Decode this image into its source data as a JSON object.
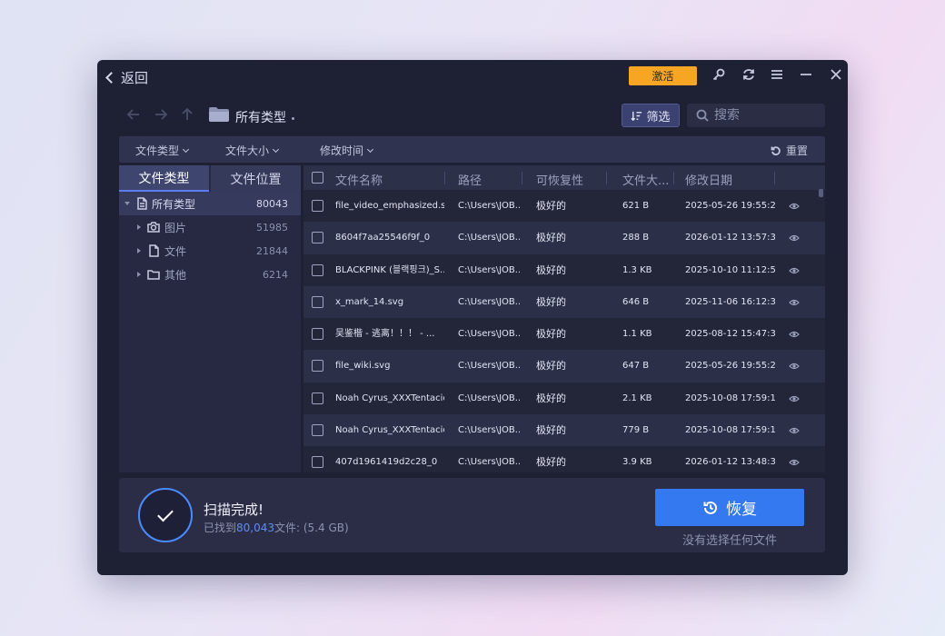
{
  "header": {
    "back_label": "返回",
    "activate_label": "激活"
  },
  "nav": {
    "breadcrumb": "所有类型",
    "filter_label": "筛选",
    "search_placeholder": "搜索"
  },
  "filter_bar": {
    "file_type": "文件类型",
    "file_size": "文件大小",
    "modified_time": "修改时间",
    "reset": "重置"
  },
  "left_panel": {
    "tabs": [
      "文件类型",
      "文件位置"
    ],
    "tree": [
      {
        "label": "所有类型",
        "count": "80043"
      },
      {
        "label": "图片",
        "count": "51985"
      },
      {
        "label": "文件",
        "count": "21844"
      },
      {
        "label": "其他",
        "count": "6214"
      }
    ]
  },
  "table": {
    "headers": {
      "name": "文件名称",
      "path": "路径",
      "recoverability": "可恢复性",
      "size": "文件大...",
      "modified": "修改日期"
    },
    "rows": [
      {
        "name": "file_video_emphasized.s...",
        "path": "C:\\Users\\JOB...",
        "recoverability": "极好的",
        "size": "621 B",
        "modified": "2025-05-26 19:55:24"
      },
      {
        "name": "8604f7aa25546f9f_0",
        "path": "C:\\Users\\JOB...",
        "recoverability": "极好的",
        "size": "288 B",
        "modified": "2026-01-12 13:57:30"
      },
      {
        "name": "BLACKPINK (블랙핑크)_S...",
        "path": "C:\\Users\\JOB...",
        "recoverability": "极好的",
        "size": "1.3 KB",
        "modified": "2025-10-10 11:12:50"
      },
      {
        "name": "x_mark_14.svg",
        "path": "C:\\Users\\JOB...",
        "recoverability": "极好的",
        "size": "646 B",
        "modified": "2025-11-06 16:12:30"
      },
      {
        "name": "吴鉴楷 - 逃离！！！ - ...",
        "path": "C:\\Users\\JOB...",
        "recoverability": "极好的",
        "size": "1.1 KB",
        "modified": "2025-08-12 15:47:37"
      },
      {
        "name": "file_wiki.svg",
        "path": "C:\\Users\\JOB...",
        "recoverability": "极好的",
        "size": "647 B",
        "modified": "2025-05-26 19:55:24"
      },
      {
        "name": "Noah Cyrus_XXXTentacio...",
        "path": "C:\\Users\\JOB...",
        "recoverability": "极好的",
        "size": "2.1 KB",
        "modified": "2025-10-08 17:59:19"
      },
      {
        "name": "Noah Cyrus_XXXTentacio...",
        "path": "C:\\Users\\JOB...",
        "recoverability": "极好的",
        "size": "779 B",
        "modified": "2025-10-08 17:59:19"
      },
      {
        "name": "407d1961419d2c28_0",
        "path": "C:\\Users\\JOB...",
        "recoverability": "极好的",
        "size": "3.9 KB",
        "modified": "2026-01-12 13:48:33"
      }
    ]
  },
  "footer": {
    "status_title": "扫描完成!",
    "found_prefix": "已找到",
    "found_count": "80,043",
    "found_suffix": "文件: (5.4 GB)",
    "recover_label": "恢复",
    "no_selection": "没有选择任何文件"
  },
  "colors": {
    "accent": "#3479ef",
    "activate": "#f6a623",
    "window_bg": "#1e2033"
  }
}
